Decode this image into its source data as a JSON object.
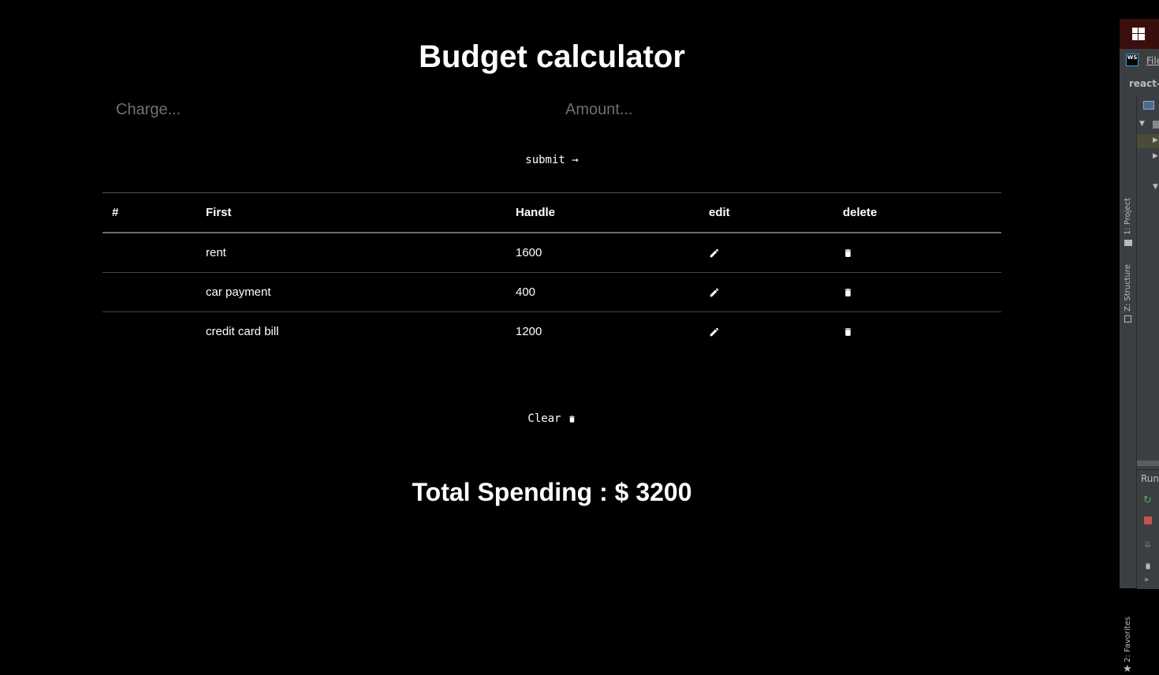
{
  "app": {
    "title": "Budget calculator",
    "charge_placeholder": "Charge...",
    "amount_placeholder": "Amount...",
    "submit_label": "submit",
    "submit_arrow": "→",
    "table": {
      "headers": [
        "#",
        "First",
        "Handle",
        "edit",
        "delete"
      ],
      "rows": [
        {
          "num": "",
          "first": "rent",
          "handle": "1600"
        },
        {
          "num": "",
          "first": "car payment",
          "handle": "400"
        },
        {
          "num": "",
          "first": "credit card bill",
          "handle": "1200"
        }
      ]
    },
    "clear_label": "Clear",
    "total_text": "Total Spending : $ 3200"
  },
  "ide": {
    "menu_file": "File",
    "nav_project": "react-b",
    "tab_project": "1: Project",
    "tab_structure": "Z: Structure",
    "tab_favorites": "2: Favorites",
    "run_label": "Run:"
  },
  "icons": {
    "edit": "pencil-icon",
    "delete": "trash-icon",
    "windows": "windows-logo-icon",
    "webstorm": "webstorm-logo-icon"
  },
  "colors": {
    "background": "#000000",
    "text": "#ffffff",
    "placeholder": "#6f6f6f",
    "ide_panel": "#3c3f41",
    "ide_titlebar": "#3b0e0e"
  }
}
